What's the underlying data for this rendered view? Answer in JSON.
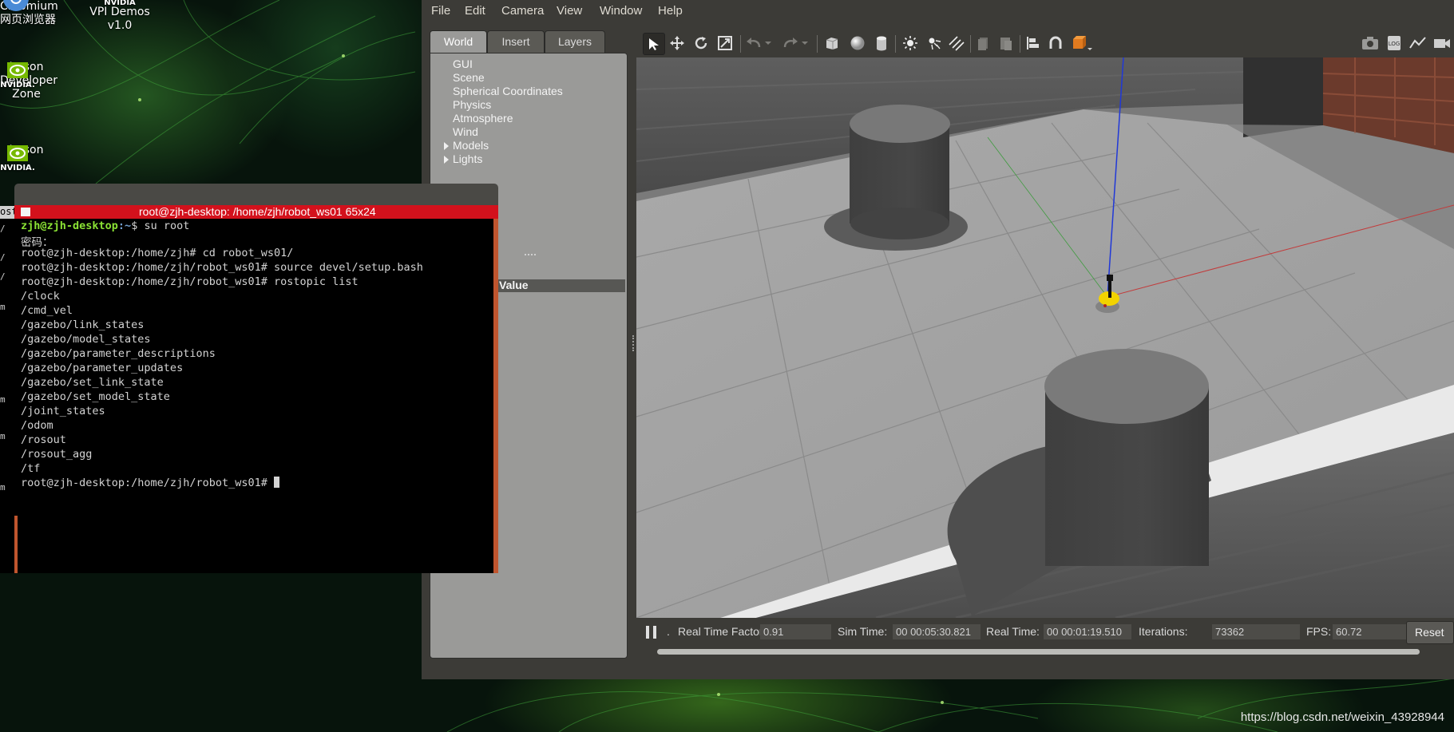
{
  "desktop": {
    "icons": [
      {
        "line1": "Chromium",
        "line2": "网页浏览器"
      },
      {
        "line1": "VPI Demos",
        "line2": "v1.0"
      },
      {
        "line1": "Jetson",
        "line2": "Developer",
        "line3": "Zone"
      },
      {
        "line1": "Jetson"
      }
    ],
    "nvidia_text": "NVIDIA",
    "watermark": "https://blog.csdn.net/weixin_43928944"
  },
  "gazebo": {
    "menu": [
      "File",
      "Edit",
      "Camera",
      "View",
      "Window",
      "Help"
    ],
    "tabs": [
      "World",
      "Insert",
      "Layers"
    ],
    "world_tree": [
      "GUI",
      "Scene",
      "Spherical Coordinates",
      "Physics",
      "Atmosphere",
      "Wind",
      "Models",
      "Lights"
    ],
    "property_header": "Value",
    "toolbar_icons": [
      "select-mode-icon",
      "translate-mode-icon",
      "rotate-mode-icon",
      "scale-mode-icon",
      "undo-icon",
      "redo-icon",
      "box-icon",
      "sphere-icon",
      "cylinder-icon",
      "point-light-icon",
      "spot-light-icon",
      "directional-light-icon",
      "copy-icon",
      "paste-icon",
      "align-icon",
      "snap-icon",
      "view-angle-icon",
      "screenshot-icon",
      "log-icon",
      "plot-icon"
    ],
    "status": {
      "real_time_factor_label": "Real Time Factor:",
      "real_time_factor": "0.91",
      "sim_time_label": "Sim Time:",
      "sim_time": "00 00:05:30.821",
      "real_time_label": "Real Time:",
      "real_time": "00 00:01:19.510",
      "iterations_label": "Iterations:",
      "iterations": "73362",
      "fps_label": "FPS:",
      "fps": "60.72",
      "reset_label": "Reset"
    }
  },
  "terminal": {
    "title": "root@zjh-desktop: /home/zjh/robot_ws01 65x24",
    "bg_tab": "ost",
    "line1_user": "zjh@zjh-desktop",
    "line1_path": ":~",
    "line1_cmd": "$ su root",
    "lines": [
      "密码：",
      "root@zjh-desktop:/home/zjh# cd robot_ws01/",
      "root@zjh-desktop:/home/zjh/robot_ws01# source devel/setup.bash",
      "root@zjh-desktop:/home/zjh/robot_ws01# rostopic list",
      "/clock",
      "/cmd_vel",
      "/gazebo/link_states",
      "/gazebo/model_states",
      "/gazebo/parameter_descriptions",
      "/gazebo/parameter_updates",
      "/gazebo/set_link_state",
      "/gazebo/set_model_state",
      "/joint_states",
      "/odom",
      "/rosout",
      "/rosout_agg",
      "/tf"
    ],
    "prompt": "root@zjh-desktop:/home/zjh/robot_ws01# "
  }
}
